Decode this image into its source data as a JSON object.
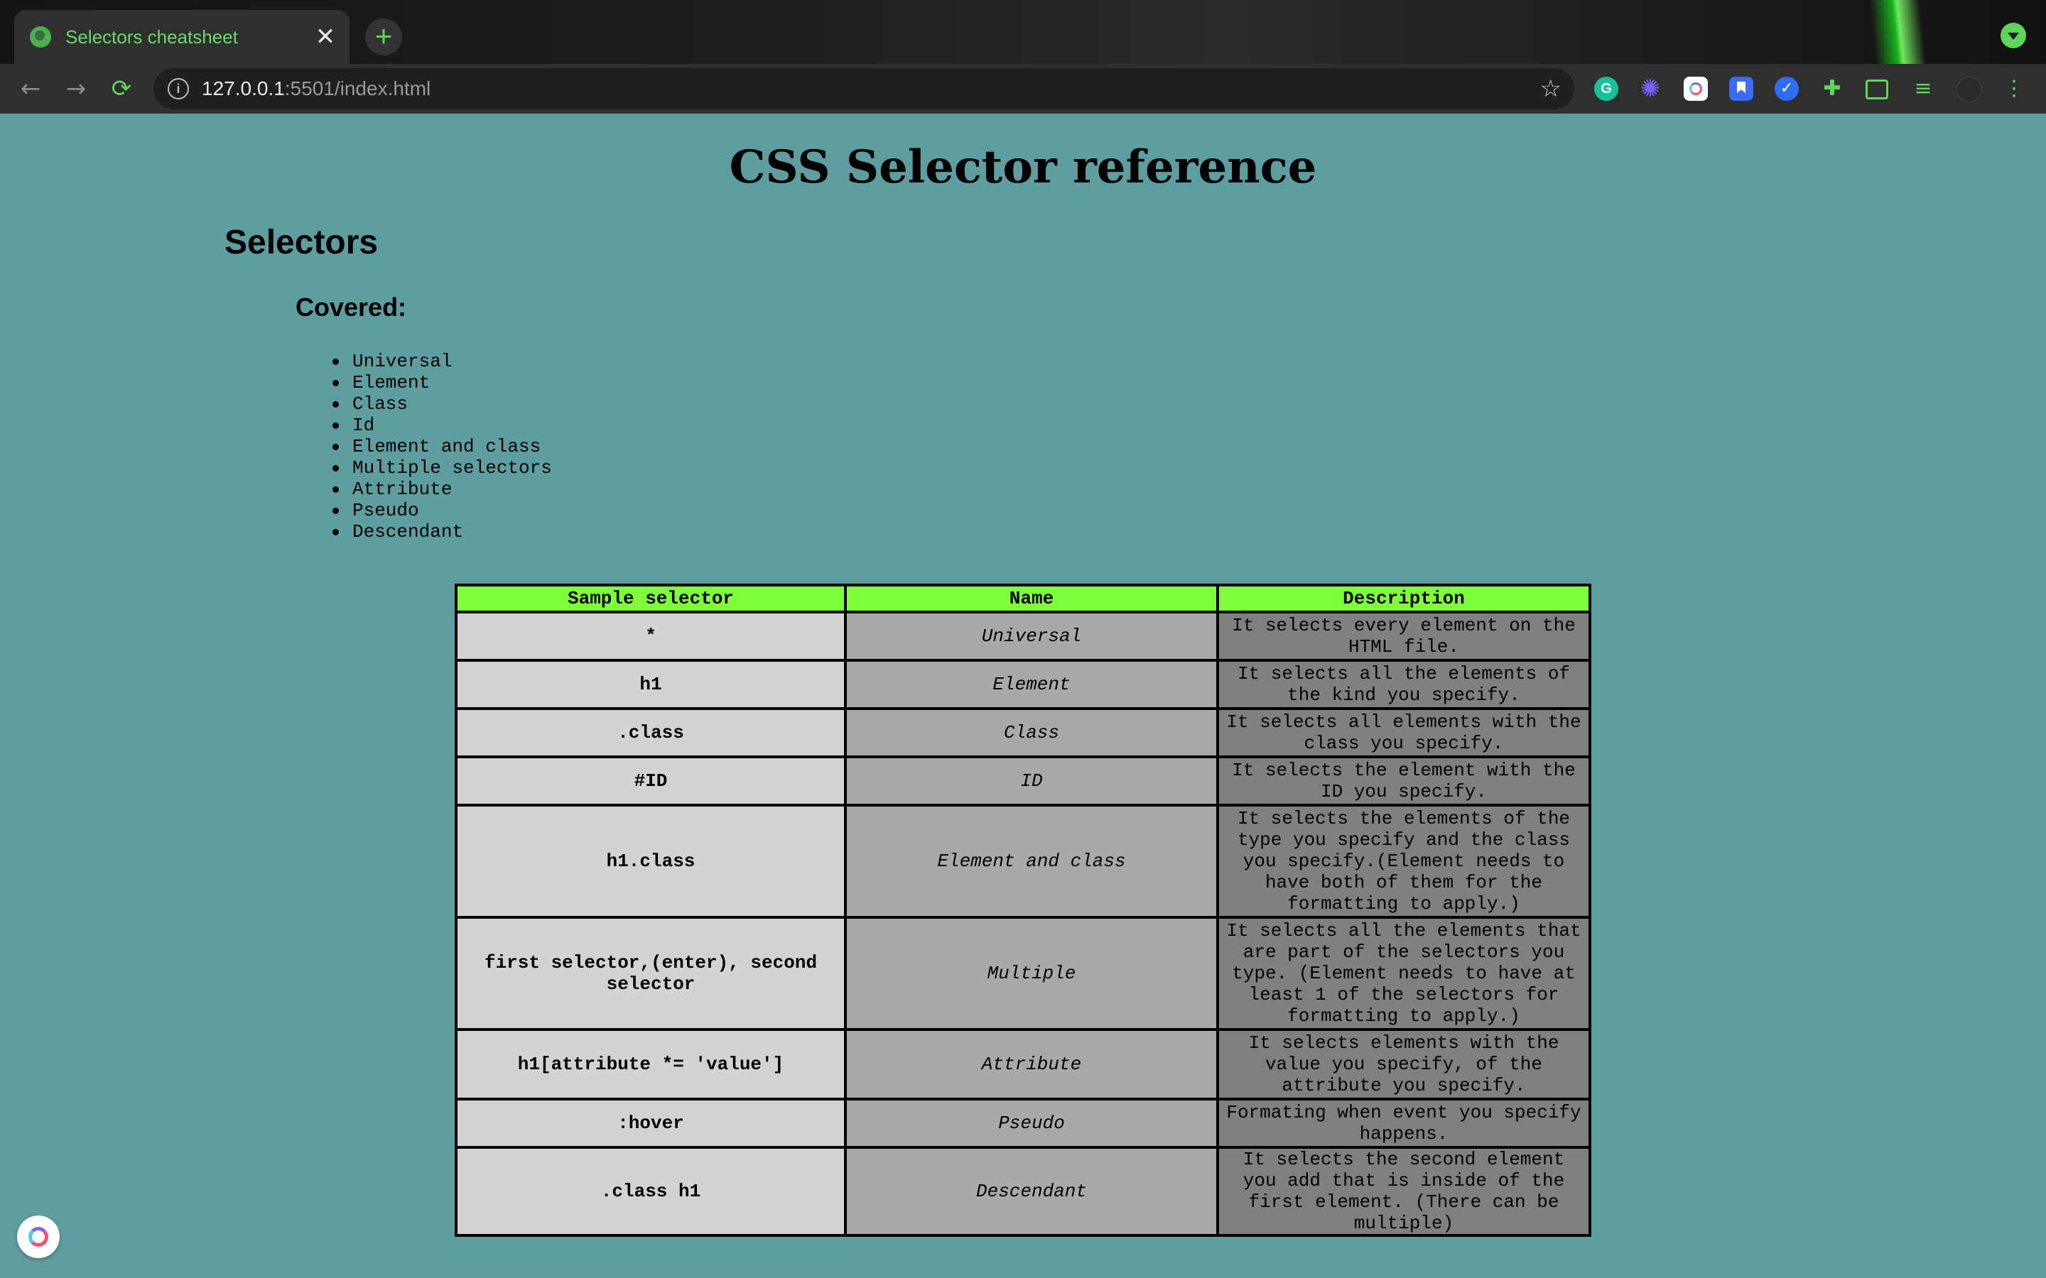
{
  "browser": {
    "tab_title": "Selectors cheatsheet",
    "close_glyph": "✕",
    "newtab_glyph": "+",
    "url_host": "127.0.0.1",
    "url_rest": ":5501/index.html",
    "back_glyph": "←",
    "forward_glyph": "→",
    "reload_glyph": "⟳",
    "star_glyph": "☆",
    "extensions": [
      "grammarly-icon",
      "gear-icon",
      "clickup-icon",
      "bookmark-icon",
      "check-icon",
      "puzzle-icon",
      "cast-icon",
      "queue-icon",
      "avatar-icon",
      "menu-icon"
    ]
  },
  "page": {
    "title": "CSS Selector reference",
    "heading": "Selectors",
    "subheading": "Covered:",
    "covered": [
      "Universal",
      "Element",
      "Class",
      "Id",
      "Element and class",
      "Multiple selectors",
      "Attribute",
      "Pseudo",
      "Descendant"
    ]
  },
  "table": {
    "headers": [
      "Sample selector",
      "Name",
      "Description"
    ],
    "rows": [
      {
        "selector": "*",
        "name": "Universal",
        "description": "It selects every element on the HTML file."
      },
      {
        "selector": "h1",
        "name": "Element",
        "description": "It selects all the elements of the kind you specify."
      },
      {
        "selector": ".class",
        "name": "Class",
        "description": "It selects all elements with the class you specify."
      },
      {
        "selector": "#ID",
        "name": "ID",
        "description": "It selects the element with the ID you specify."
      },
      {
        "selector": "h1.class",
        "name": "Element and class",
        "description": "It selects the elements of the type you specify and the class you specify.(Element needs to have both of them for the formatting to apply.)"
      },
      {
        "selector": "first selector,(enter), second selector",
        "name": "Multiple",
        "description": "It selects all the elements that are part of the selectors you type. (Element needs to have at least 1 of the selectors for formatting to apply.)"
      },
      {
        "selector": "h1[attribute *= 'value']",
        "name": "Attribute",
        "description": "It selects elements with the value you specify, of the attribute you specify."
      },
      {
        "selector": ":hover",
        "name": "Pseudo",
        "description": "Formating when event you specify happens."
      },
      {
        "selector": ".class h1",
        "name": "Descendant",
        "description": "It selects the second element you add that is inside of the first element. (There can be multiple)"
      }
    ]
  },
  "colors": {
    "page_bg": "#5f9ea0",
    "header_bg": "#7fff3a",
    "col1_bg": "#d3d3d3",
    "col2_bg": "#a9a9a9",
    "col3_bg": "#808080"
  }
}
